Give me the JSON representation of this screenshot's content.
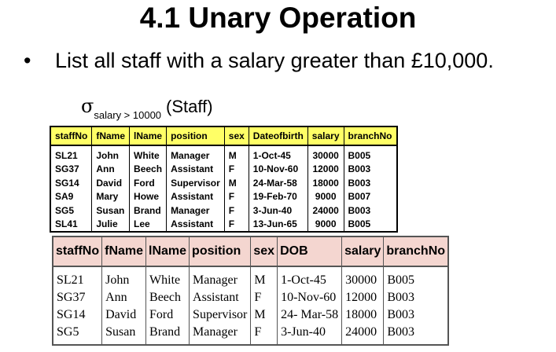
{
  "title": "4.1 Unary Operation",
  "bullet": {
    "marker": "•",
    "text": "List all staff with a salary greater than £10,000."
  },
  "expression": {
    "sigma": "σ",
    "predicate": "salary > 10000",
    "relation": "(Staff)"
  },
  "table1": {
    "headers": [
      "staffNo",
      "fName",
      "lName",
      "position",
      "sex",
      "Dateofbirth",
      "salary",
      "branchNo"
    ],
    "rows": [
      [
        "SL21",
        "John",
        "White",
        "Manager",
        "M",
        "1-Oct-45",
        "30000",
        "B005"
      ],
      [
        "SG37",
        "Ann",
        "Beech",
        "Assistant",
        "F",
        "10-Nov-60",
        "12000",
        "B003"
      ],
      [
        "SG14",
        "David",
        "Ford",
        "Supervisor",
        "M",
        "24-Mar-58",
        "18000",
        "B003"
      ],
      [
        "SA9",
        "Mary",
        "Howe",
        "Assistant",
        "F",
        "19-Feb-70",
        "9000",
        "B007"
      ],
      [
        "SG5",
        "Susan",
        "Brand",
        "Manager",
        "F",
        "3-Jun-40",
        "24000",
        "B003"
      ],
      [
        "SL41",
        "Julie",
        "Lee",
        "Assistant",
        "F",
        "13-Jun-65",
        "9000",
        "B005"
      ]
    ]
  },
  "table2": {
    "headers": [
      "staffNo",
      "fName",
      "lName",
      "position",
      "sex",
      "DOB",
      "salary",
      "branchNo"
    ],
    "rows": [
      [
        "SL21",
        "John",
        "White",
        "Manager",
        "M",
        "1-Oct-45",
        "30000",
        "B005"
      ],
      [
        "SG37",
        "Ann",
        "Beech",
        "Assistant",
        "F",
        "10-Nov-60",
        "12000",
        "B003"
      ],
      [
        "SG14",
        "David",
        "Ford",
        "Supervisor",
        "M",
        "24- Mar-58",
        "18000",
        "B003"
      ],
      [
        "SG5",
        "Susan",
        "Brand",
        "Manager",
        "F",
        "3-Jun-40",
        "24000",
        "B003"
      ]
    ]
  },
  "colors": {
    "table1_header_bg": "#ffff66",
    "table2_header_bg": "#f4d6d0"
  }
}
